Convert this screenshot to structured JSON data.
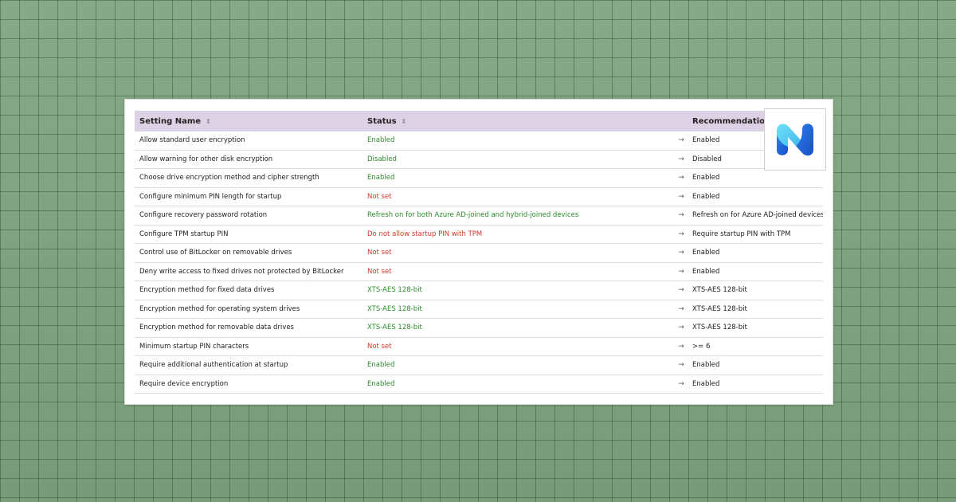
{
  "table": {
    "headers": {
      "setting_name": "Setting Name",
      "status": "Status",
      "recommendation": "Recommendation"
    },
    "rows": [
      {
        "name": "Allow standard user encryption",
        "status": "Enabled",
        "status_color": "green",
        "recommendation": "Enabled"
      },
      {
        "name": "Allow warning for other disk encryption",
        "status": "Disabled",
        "status_color": "green",
        "recommendation": "Disabled"
      },
      {
        "name": "Choose drive encryption method and cipher strength",
        "status": "Enabled",
        "status_color": "green",
        "recommendation": "Enabled"
      },
      {
        "name": "Configure minimum PIN length for startup",
        "status": "Not set",
        "status_color": "red",
        "recommendation": "Enabled"
      },
      {
        "name": "Configure recovery password rotation",
        "status": "Refresh on for both Azure AD-joined and hybrid-joined devices",
        "status_color": "green",
        "recommendation": "Refresh on for Azure AD-joined devices"
      },
      {
        "name": "Configure TPM startup PIN",
        "status": "Do not allow startup PIN with TPM",
        "status_color": "red",
        "recommendation": "Require startup PIN with TPM"
      },
      {
        "name": "Control use of BitLocker on removable drives",
        "status": "Not set",
        "status_color": "red",
        "recommendation": "Enabled"
      },
      {
        "name": "Deny write access to fixed drives not protected by BitLocker",
        "status": "Not set",
        "status_color": "red",
        "recommendation": "Enabled"
      },
      {
        "name": "Encryption method for fixed data drives",
        "status": "XTS-AES 128-bit",
        "status_color": "green",
        "recommendation": "XTS-AES 128-bit"
      },
      {
        "name": "Encryption method for operating system drives",
        "status": "XTS-AES 128-bit",
        "status_color": "green",
        "recommendation": "XTS-AES 128-bit"
      },
      {
        "name": "Encryption method for removable data drives",
        "status": "XTS-AES 128-bit",
        "status_color": "green",
        "recommendation": "XTS-AES 128-bit"
      },
      {
        "name": "Minimum startup PIN characters",
        "status": "Not set",
        "status_color": "red",
        "recommendation": ">= 6"
      },
      {
        "name": "Require additional authentication at startup",
        "status": "Enabled",
        "status_color": "green",
        "recommendation": "Enabled"
      },
      {
        "name": "Require device encryption",
        "status": "Enabled",
        "status_color": "green",
        "recommendation": "Enabled"
      }
    ],
    "arrow_glyph": "→",
    "sort_glyph": "⇕"
  },
  "colors": {
    "header_bg": "#ddd1e6",
    "status_green": "#2e8b2e",
    "status_red": "#d23a2a",
    "logo_light": "#5fd0f0",
    "logo_dark": "#1f5fd6"
  },
  "logo": {
    "icon": "n-logo-icon"
  }
}
